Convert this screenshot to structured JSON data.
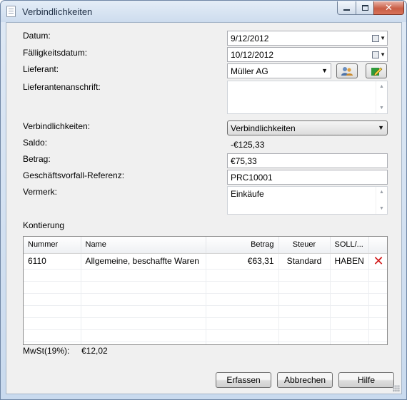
{
  "window": {
    "title": "Verbindlichkeiten",
    "buttons": {
      "minimize": "–",
      "maximize": "□",
      "close": "✕"
    }
  },
  "form": {
    "datum": {
      "label": "Datum:",
      "value": "9/12/2012"
    },
    "faelligkeit": {
      "label": "Fälligkeitsdatum:",
      "value": "10/12/2012"
    },
    "lieferant": {
      "label": "Lieferant:",
      "value": "Müller AG"
    },
    "anschrift": {
      "label": "Lieferantenanschrift:",
      "value": ""
    },
    "verbindlichkeiten": {
      "label": "Verbindlichkeiten:",
      "value": "Verbindlichkeiten"
    },
    "saldo": {
      "label": "Saldo:",
      "value": "-€125,33"
    },
    "betrag": {
      "label": "Betrag:",
      "value": "€75,33"
    },
    "referenz": {
      "label": "Geschäftsvorfall-Referenz:",
      "value": "PRC10001"
    },
    "vermerk": {
      "label": "Vermerk:",
      "value": "Einkäufe"
    }
  },
  "kontierung": {
    "label": "Kontierung",
    "columns": [
      "Nummer",
      "Name",
      "Betrag",
      "Steuer",
      "SOLL/..."
    ],
    "rows": [
      {
        "nummer": "6110",
        "name": "Allgemeine, beschaffte Waren",
        "betrag": "€63,31",
        "steuer": "Standard",
        "soll": "HABEN"
      }
    ]
  },
  "mwst": {
    "label": "MwSt(19%):",
    "value": "€12,02"
  },
  "actions": {
    "erfassen": "Erfassen",
    "abbrechen": "Abbrechen",
    "hilfe": "Hilfe"
  },
  "icons": {
    "calendar": "calendar-icon",
    "lieferant_select": "people-icon",
    "lieferant_edit": "edit-icon",
    "delete_row": "delete-icon"
  },
  "colors": {
    "delete": "#d11a1a",
    "title_bar": "#cddcee",
    "close_button": "#c85d45"
  }
}
